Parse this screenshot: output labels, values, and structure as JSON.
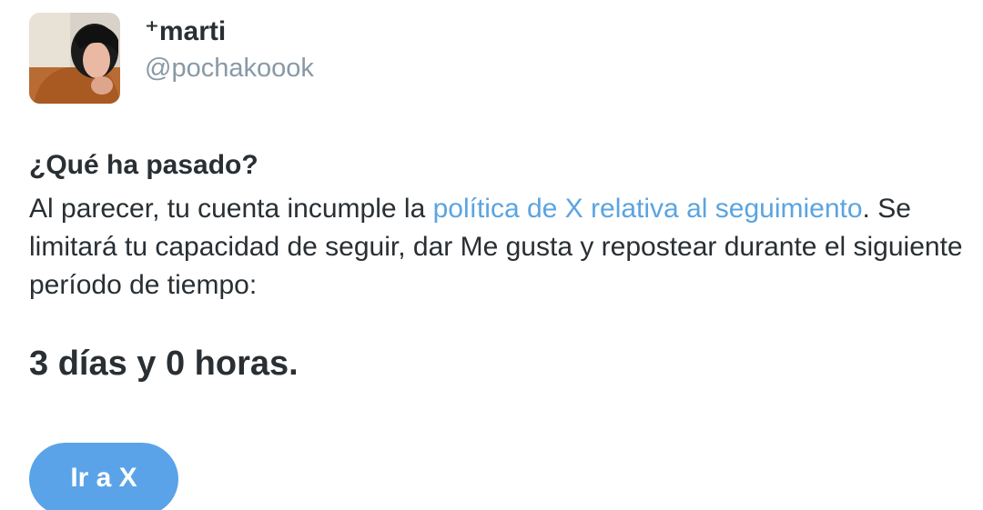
{
  "user": {
    "display_name": "⁺marti",
    "handle": "@pochakoook",
    "avatar_icon": "profile-photo"
  },
  "notice": {
    "heading": "¿Qué ha pasado?",
    "text_before_link": "Al parecer, tu cuenta incumple la ",
    "link_text": "política de X relativa al seguimiento",
    "text_after_link": ". Se limitará tu capacidad de seguir, dar Me gusta y repostear durante el siguiente período de tiempo:",
    "duration": "3 días y 0 horas."
  },
  "actions": {
    "go_button_label": "Ir a X"
  },
  "colors": {
    "link": "#5ba4e0",
    "button": "#5aa3e8",
    "handle": "#8899a6",
    "text": "#292f33"
  }
}
